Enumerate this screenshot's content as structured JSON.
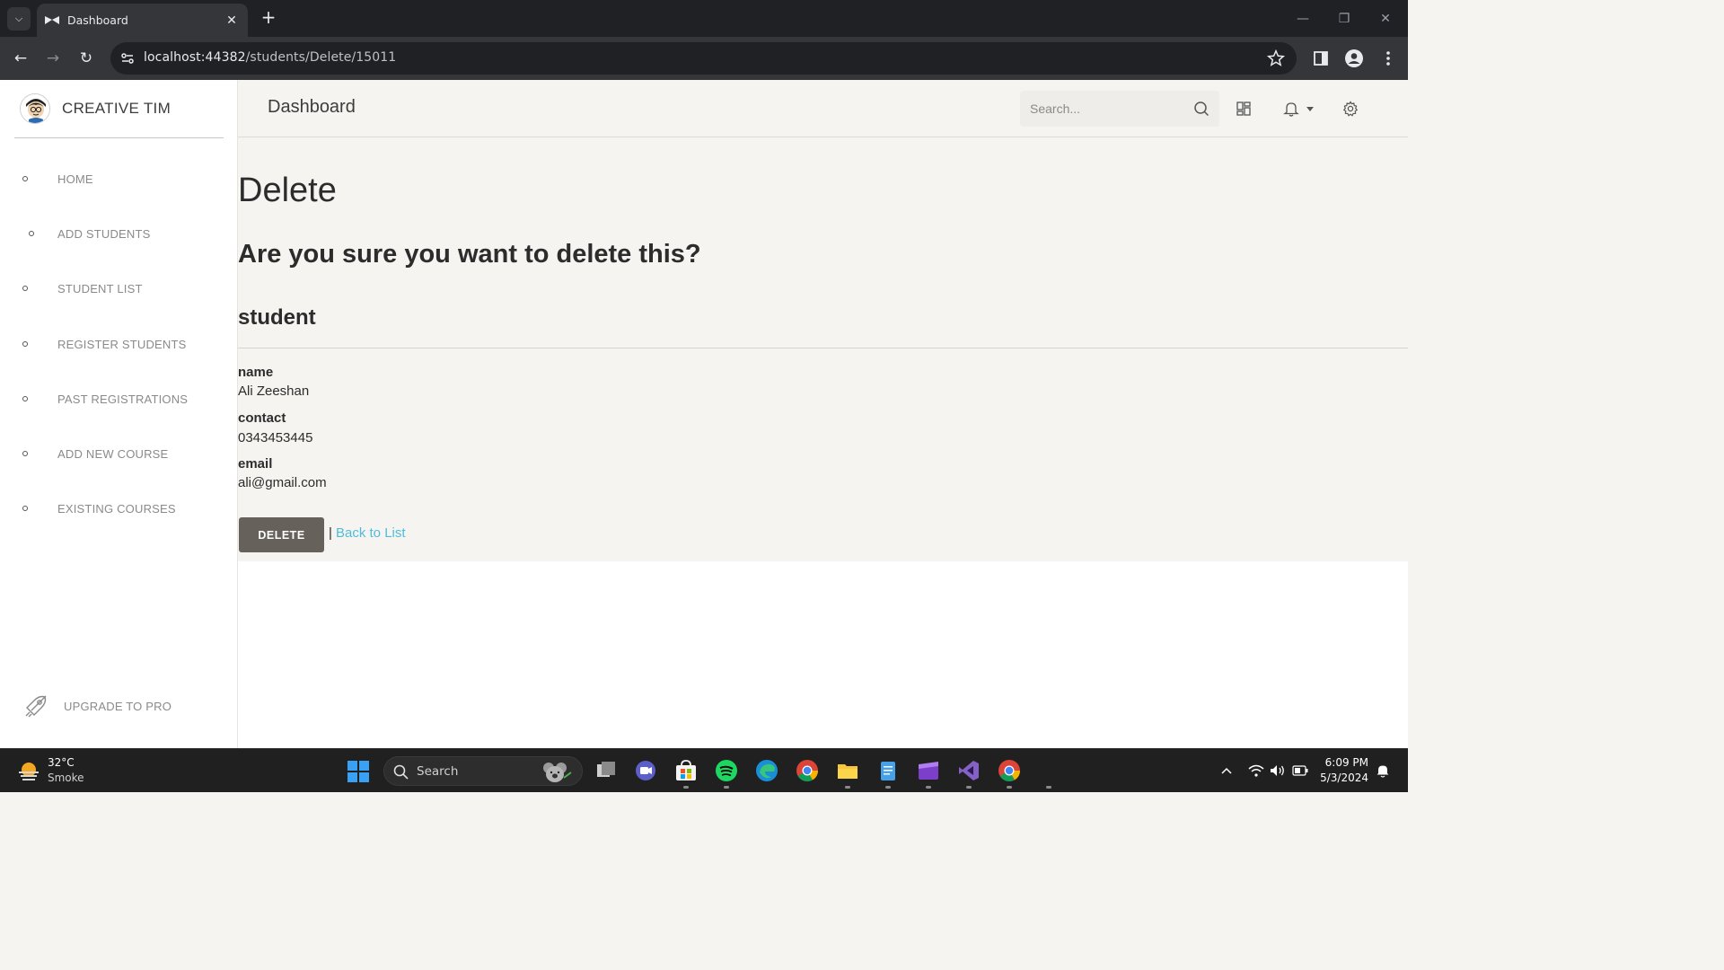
{
  "browser": {
    "tab_title": "Dashboard",
    "url_host": "localhost:44382",
    "url_path": "/students/Delete/15011"
  },
  "sidebar": {
    "brand": "CREATIVE TIM",
    "items": [
      {
        "label": "HOME"
      },
      {
        "label": "ADD STUDENTS"
      },
      {
        "label": "STUDENT LIST"
      },
      {
        "label": "REGISTER STUDENTS"
      },
      {
        "label": "PAST REGISTRATIONS"
      },
      {
        "label": "ADD NEW COURSE"
      },
      {
        "label": "EXISTING COURSES"
      }
    ],
    "upgrade_label": "UPGRADE TO PRO"
  },
  "header": {
    "title": "Dashboard",
    "search_placeholder": "Search..."
  },
  "main": {
    "heading": "Delete",
    "question": "Are you sure you want to delete this?",
    "entity": "student",
    "fields": [
      {
        "label": "name",
        "value": "Ali Zeeshan"
      },
      {
        "label": "contact",
        "value": "0343453445"
      },
      {
        "label": "email",
        "value": "ali@gmail.com"
      }
    ],
    "delete_label": "DELETE",
    "separator": "|",
    "back_label": "Back to List"
  },
  "taskbar": {
    "weather_temp": "32°C",
    "weather_desc": "Smoke",
    "search_label": "Search",
    "time": "6:09 PM",
    "date": "5/3/2024"
  },
  "colors": {
    "delete_button": "#66615b",
    "link": "#51bcda",
    "content_bg": "#f5f4f1"
  }
}
